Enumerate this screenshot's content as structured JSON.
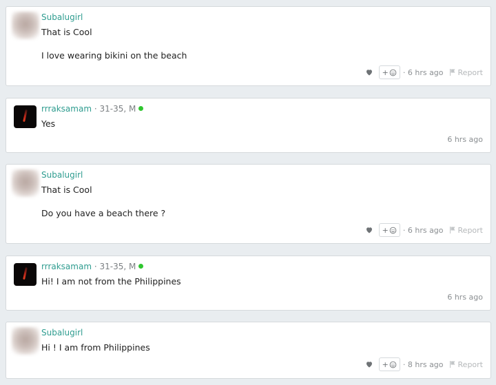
{
  "messages": [
    {
      "username": "Subalugirl",
      "lines": [
        "That is Cool",
        "I love wearing bikini on the beach"
      ],
      "time": "· 6 hrs ago",
      "react_label": "+",
      "report_label": "Report"
    },
    {
      "username": "rrraksamam",
      "details": " · 31-35, M",
      "lines": [
        "Yes"
      ],
      "time": "6 hrs ago"
    },
    {
      "username": "Subalugirl",
      "lines": [
        "That is Cool",
        "Do you have a beach there ?"
      ],
      "time": "· 6 hrs ago",
      "react_label": "+",
      "report_label": "Report"
    },
    {
      "username": "rrraksamam",
      "details": " · 31-35, M",
      "lines": [
        "Hi! I am not from the Philippines"
      ],
      "time": "6 hrs ago"
    },
    {
      "username": "Subalugirl",
      "lines": [
        "Hi ! I am from Philippines"
      ],
      "time": "· 8 hrs ago",
      "react_label": "+",
      "report_label": "Report"
    }
  ],
  "colors": {
    "username": "#2e9c8f",
    "online": "#2fc62f",
    "background": "#e9edf0"
  }
}
